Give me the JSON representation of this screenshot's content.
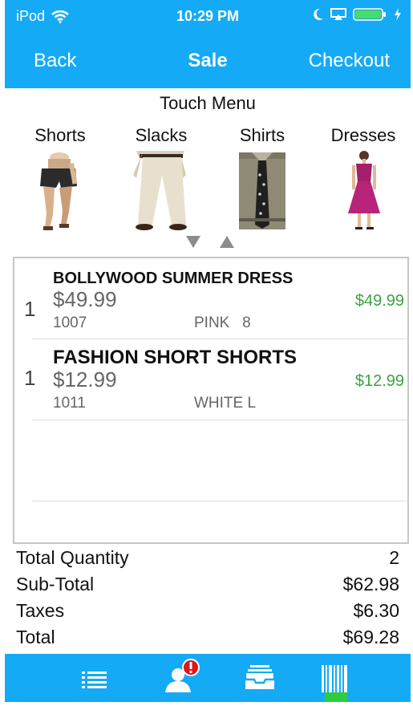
{
  "status": {
    "carrier": "iPod",
    "time": "10:29 PM"
  },
  "nav": {
    "back": "Back",
    "title": "Sale",
    "checkout": "Checkout"
  },
  "touch_menu": {
    "title": "Touch Menu",
    "categories": [
      {
        "label": "Shorts",
        "icon": "shorts-icon"
      },
      {
        "label": "Slacks",
        "icon": "slacks-icon"
      },
      {
        "label": "Shirts",
        "icon": "shirt-icon"
      },
      {
        "label": "Dresses",
        "icon": "dress-icon"
      }
    ]
  },
  "cart": {
    "items": [
      {
        "qty": "1",
        "name": "BOLLYWOOD SUMMER DRESS",
        "price": "$49.99",
        "sku": "1007",
        "variant": "PINK   8",
        "ext": "$49.99"
      },
      {
        "qty": "1",
        "name": "FASHION SHORT SHORTS",
        "price": "$12.99",
        "sku": "1011",
        "variant": "WHITE L",
        "ext": "$12.99"
      }
    ]
  },
  "totals": {
    "quantity_label": "Total Quantity",
    "quantity_value": "2",
    "subtotal_label": "Sub-Total",
    "subtotal_value": "$62.98",
    "taxes_label": "Taxes",
    "taxes_value": "$6.30",
    "total_label": "Total",
    "total_value": "$69.28"
  },
  "colors": {
    "accent": "#14aaf5",
    "price_green": "#39a53f",
    "alert_red": "#e0151b"
  },
  "tabs": [
    {
      "icon": "list-icon"
    },
    {
      "icon": "customer-alert-icon"
    },
    {
      "icon": "inbox-icon"
    },
    {
      "icon": "barcode-icon"
    }
  ]
}
